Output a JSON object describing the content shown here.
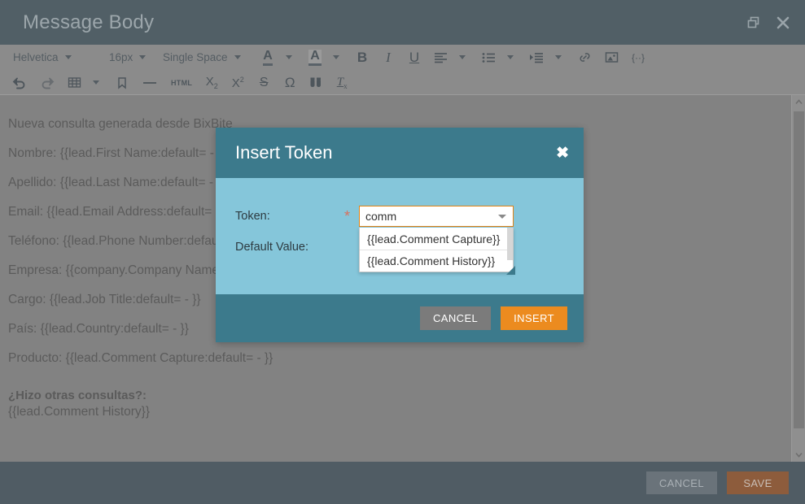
{
  "window": {
    "title": "Message Body",
    "restore_icon": "restore-window-icon",
    "close_icon": "close-icon"
  },
  "toolbar": {
    "font_family": "Helvetica",
    "font_size": "16px",
    "line_spacing": "Single Space",
    "row1_icons": [
      "font-color-icon",
      "highlight-color-icon",
      "bold-icon",
      "italic-icon",
      "underline-icon",
      "align-icon",
      "bullet-list-icon",
      "indent-icon",
      "link-icon",
      "image-icon",
      "code-snippet-icon"
    ],
    "row2_icons": [
      "undo-icon",
      "redo-icon",
      "table-icon",
      "bookmark-icon",
      "horizontal-rule-icon",
      "html-icon",
      "subscript-icon",
      "superscript-icon",
      "strikethrough-icon",
      "special-character-icon",
      "find-replace-icon",
      "clear-formatting-icon"
    ],
    "bold_label": "B",
    "italic_label": "I",
    "underline_label": "U",
    "html_label": "HTML",
    "omega_label": "Ω",
    "code_label": "{··}"
  },
  "editor": {
    "lines": [
      "Nueva consulta generada desde BixBite",
      "Nombre: {{lead.First Name:default= - }}",
      "Apellido: {{lead.Last Name:default= - }}",
      "Email: {{lead.Email Address:default= - }}",
      "Teléfono: {{lead.Phone Number:default= - }}",
      "Empresa: {{company.Company Name:default= - }}",
      "Cargo: {{lead.Job Title:default= - }}",
      "País: {{lead.Country:default= - }}",
      "Producto: {{lead.Comment Capture:default= - }}"
    ],
    "question_heading": "¿Hizo otras consultas?:",
    "question_token": "{{lead.Comment History}}"
  },
  "modal": {
    "title": "Insert Token",
    "close_icon": "close-icon",
    "token_label": "Token:",
    "token_required_mark": "*",
    "token_value": "comm",
    "default_value_label": "Default Value:",
    "default_value": "",
    "dropdown_options": [
      "{{lead.Comment Capture}}",
      "{{lead.Comment History}}"
    ],
    "cancel_label": "CANCEL",
    "insert_label": "INSERT"
  },
  "footer": {
    "cancel_label": "CANCEL",
    "save_label": "SAVE"
  },
  "colors": {
    "titlebar": "#515f66",
    "toolbar": "#8b8b8b",
    "editor": "#828282",
    "modal_header": "#3c7a8c",
    "modal_body": "#85c6da",
    "insert_button": "#ec8b1f",
    "input_border": "#e08214",
    "required_star": "#d9715e",
    "bottom_bar": "#505c64",
    "save_button": "#8d5c3c"
  }
}
